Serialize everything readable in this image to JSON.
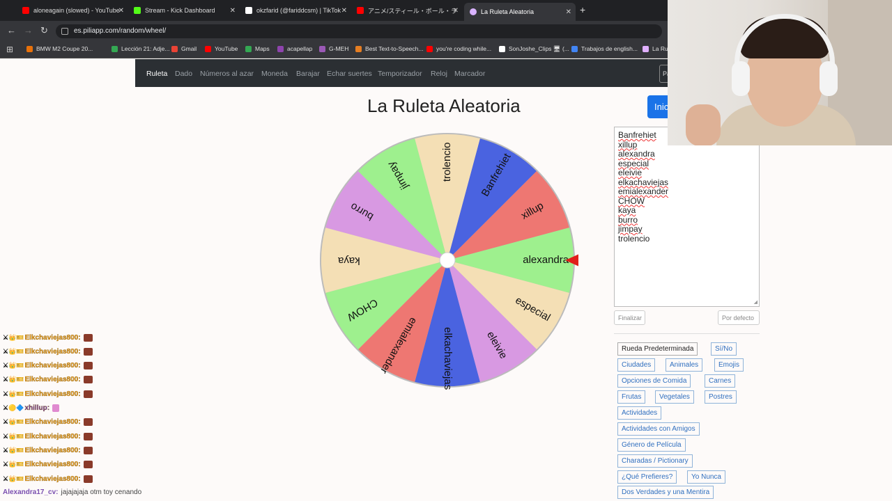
{
  "browser": {
    "tabs": [
      {
        "title": "aloneagain (slowed) - YouTube",
        "color": "#ff0000"
      },
      {
        "title": "Stream - Kick Dashboard",
        "color": "#53fc18"
      },
      {
        "title": "okzfarid (@fariddcsm) | TikTok",
        "color": "#ffffff"
      },
      {
        "title": "アニメ/スティール・ボール・ラン ジョジ",
        "color": "#ff0000"
      },
      {
        "title": "La Ruleta Aleatoria",
        "color": "#e0b0ff"
      }
    ],
    "url": "es.piliapp.com/random/wheel/",
    "bookmarks": [
      {
        "label": "BMW M2 Coupe 20...",
        "color": "#e8710a"
      },
      {
        "label": "Lección 21: Adje...",
        "color": "#ff0000"
      },
      {
        "label": "Lección 21: Adje...",
        "color": "#34a853"
      },
      {
        "label": "Gmail",
        "color": "#ea4335"
      },
      {
        "label": "YouTube",
        "color": "#ff0000"
      },
      {
        "label": "Maps",
        "color": "#34a853"
      },
      {
        "label": "acapellap",
        "color": "#8e44ad"
      },
      {
        "label": "G-MEH",
        "color": "#9b59b6"
      },
      {
        "label": "Best Text-to-Speech...",
        "color": "#e67e22"
      },
      {
        "label": "you're coding while...",
        "color": "#ff0000"
      },
      {
        "label": "SonJoshe_Clips 🖥 (...",
        "color": "#ffffff"
      },
      {
        "label": "Trabajos de english...",
        "color": "#4285f4"
      },
      {
        "label": "La Ru",
        "color": "#e0b0ff"
      }
    ]
  },
  "site_nav": {
    "items": [
      "Ruleta",
      "Dado",
      "Números al azar",
      "Moneda",
      "Barajar",
      "Echar suertes",
      "Temporizador",
      "Reloj",
      "Marcador"
    ],
    "right_button": "Pa"
  },
  "title": "La Ruleta Aleatoria",
  "start_button": "Inic",
  "wheel": {
    "segments": [
      {
        "label": "Banfrehiet",
        "color": "#4a63e0"
      },
      {
        "label": "xillup",
        "color": "#ee7772"
      },
      {
        "label": "alexandra",
        "color": "#9ef08e"
      },
      {
        "label": "especial",
        "color": "#f4dfb5"
      },
      {
        "label": "eleivie",
        "color": "#d899e2"
      },
      {
        "label": "elkachaviejas",
        "color": "#4a63e0"
      },
      {
        "label": "emialexander",
        "color": "#ee7772"
      },
      {
        "label": "CHOW",
        "color": "#9ef08e"
      },
      {
        "label": "kaya",
        "color": "#f4dfb5"
      },
      {
        "label": "burro",
        "color": "#d899e2"
      },
      {
        "label": "jimpay",
        "color": "#9ef08e"
      },
      {
        "label": "trolencio",
        "color": "#f4dfb5"
      }
    ],
    "pointer_color": "#e0201a"
  },
  "names_list": [
    {
      "text": "Banfrehiet",
      "flagged": true
    },
    {
      "text": "xillup",
      "flagged": true
    },
    {
      "text": "alexandra",
      "flagged": true
    },
    {
      "text": "especial",
      "flagged": true
    },
    {
      "text": "eleivie",
      "flagged": true
    },
    {
      "text": "elkachaviejas",
      "flagged": true
    },
    {
      "text": "emialexander",
      "flagged": true
    },
    {
      "text": "CHOW",
      "flagged": true
    },
    {
      "text": "kaya",
      "flagged": true
    },
    {
      "text": "burro",
      "flagged": true
    },
    {
      "text": "jimpay",
      "flagged": true
    },
    {
      "text": "trolencio",
      "flagged": false
    }
  ],
  "list_buttons": {
    "finish": "Finalizar",
    "default": "Por defecto"
  },
  "presets": [
    "Rueda Predeterminada",
    "Sí/No",
    "Ciudades",
    "Animales",
    "Emojis",
    "Opciones de Comida",
    "Carnes",
    "Frutas",
    "Vegetales",
    "Postres",
    "Actividades",
    "Actividades con Amigos",
    "Género de Película",
    "Charadas / Pictionary",
    "¿Qué Prefieres?",
    "Yo Nunca",
    "Dos Verdades y una Mentira"
  ],
  "chat": {
    "repeated_user": "Elkchaviejas800:",
    "other_user": "xhillup:",
    "last_user": "Alexandra17_cv:",
    "last_message": "jajajajaja otm toy cenando"
  }
}
